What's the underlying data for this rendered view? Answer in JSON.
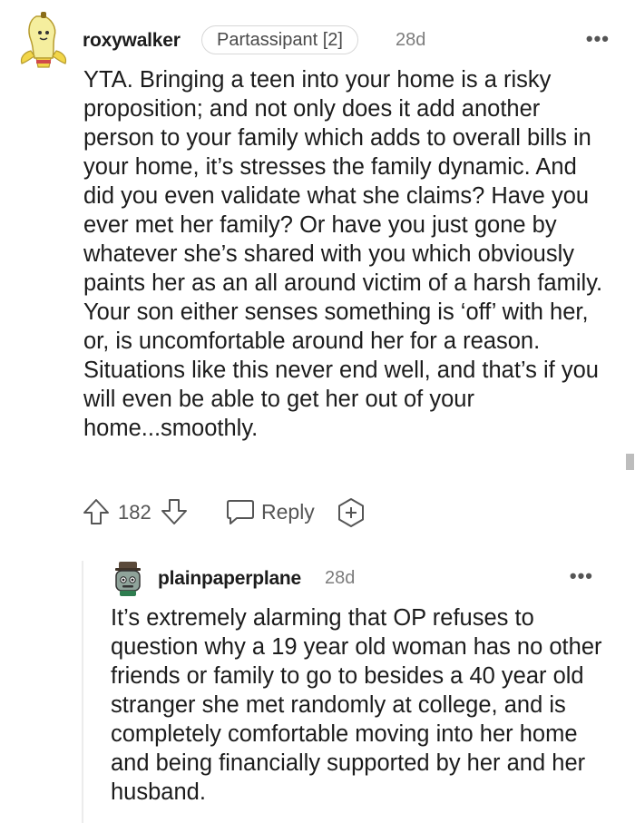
{
  "comment": {
    "username": "roxywalker",
    "flair": "Partassipant [2]",
    "timestamp": "28d",
    "more_label": "•••",
    "body": "YTA. Bringing a teen into your home is a risky proposition; and not only does it add another person to your family which adds to overall bills in your home, it’s stresses the family dynamic. And did you even validate what she claims? Have you ever met her family? Or have you just gone by whatever she’s shared with you which obviously paints her as an all around victim of a harsh family. Your son either senses something is ‘off’ with her, or, is uncomfortable around her for a reason. Situations like this never end well, and that’s if you will even be able to get her out of your home...smoothly.",
    "vote_count": "182",
    "reply_label": "Reply",
    "icons": [
      "upvote-icon",
      "downvote-icon",
      "reply-bubble-icon",
      "award-plus-icon",
      "more-dots-icon"
    ]
  },
  "reply": {
    "username": "plainpaperplane",
    "timestamp": "28d",
    "more_label": "•••",
    "body": "It’s extremely alarming that OP refuses to question why a 19 year old woman has no other friends or family to go to besides a 40 year old stranger she met randomly at college, and is completely comfortable moving into her home and being financially supported by her and her husband."
  },
  "colors": {
    "text": "#1c1c1c",
    "meta": "#7c7c7c",
    "icon": "#555555",
    "flair_border": "#d7d7d7",
    "thread_line": "#ececec"
  }
}
